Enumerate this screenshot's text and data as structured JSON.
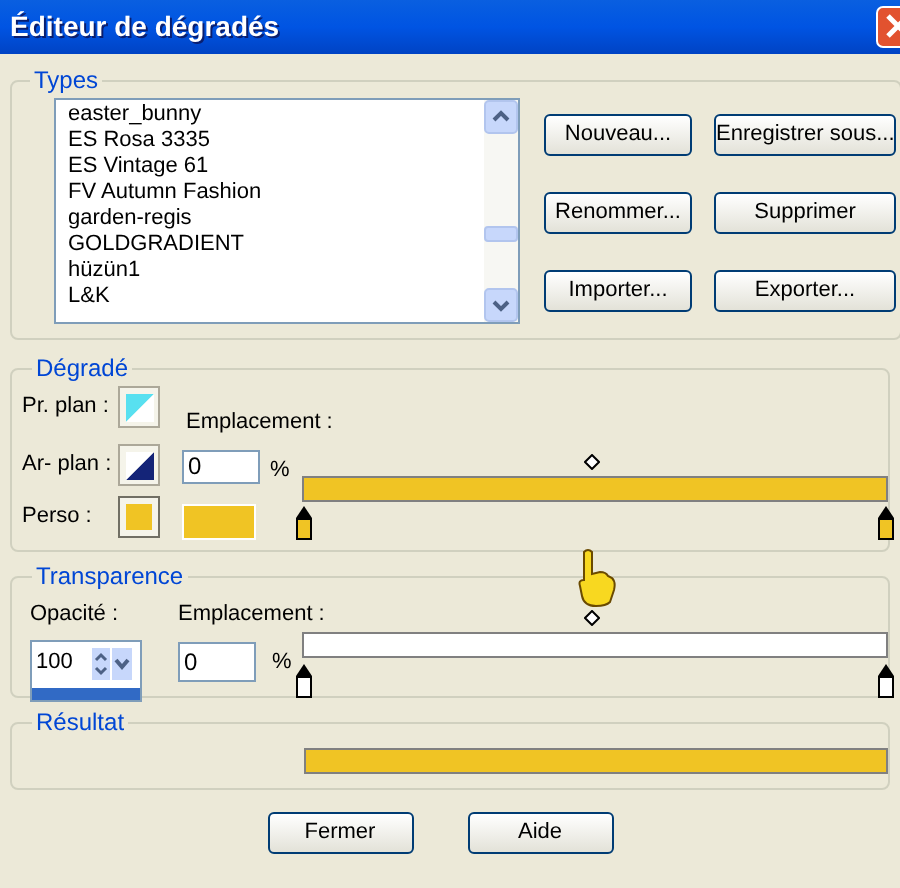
{
  "window": {
    "title": "Éditeur de dégradés"
  },
  "types": {
    "label": "Types",
    "items": [
      {
        "label": "easter_bunny",
        "selected": false
      },
      {
        "label": "ES Rosa 3335",
        "selected": false
      },
      {
        "label": "ES Vintage 61",
        "selected": false
      },
      {
        "label": "FV Autumn Fashion",
        "selected": false
      },
      {
        "label": "garden-regis",
        "selected": false
      },
      {
        "label": "GOLDGRADIENT",
        "selected": false
      },
      {
        "label": "hüzün1",
        "selected": false
      },
      {
        "label": "L&K",
        "selected": false
      }
    ],
    "buttons": [
      "Nouveau...",
      "Enregistrer sous...",
      "Renommer...",
      "Supprimer",
      "Importer...",
      "Exporter..."
    ]
  },
  "gradient": {
    "label": "Dégradé",
    "foreground_label": "Pr. plan :",
    "background_label": "Ar- plan :",
    "custom_label": "Perso :",
    "location_label": "Emplacement :",
    "location": "0",
    "percent": "%"
  },
  "transparency": {
    "label": "Transparence",
    "opacity_label": "Opacité :",
    "opacity": "100",
    "opacity_slider": {
      "level": 1
    },
    "location_label": "Emplacement :",
    "location": "0",
    "percent": "%"
  },
  "result": {
    "label": "Résultat"
  },
  "buttons": [
    "Fermer",
    "Aide"
  ]
}
